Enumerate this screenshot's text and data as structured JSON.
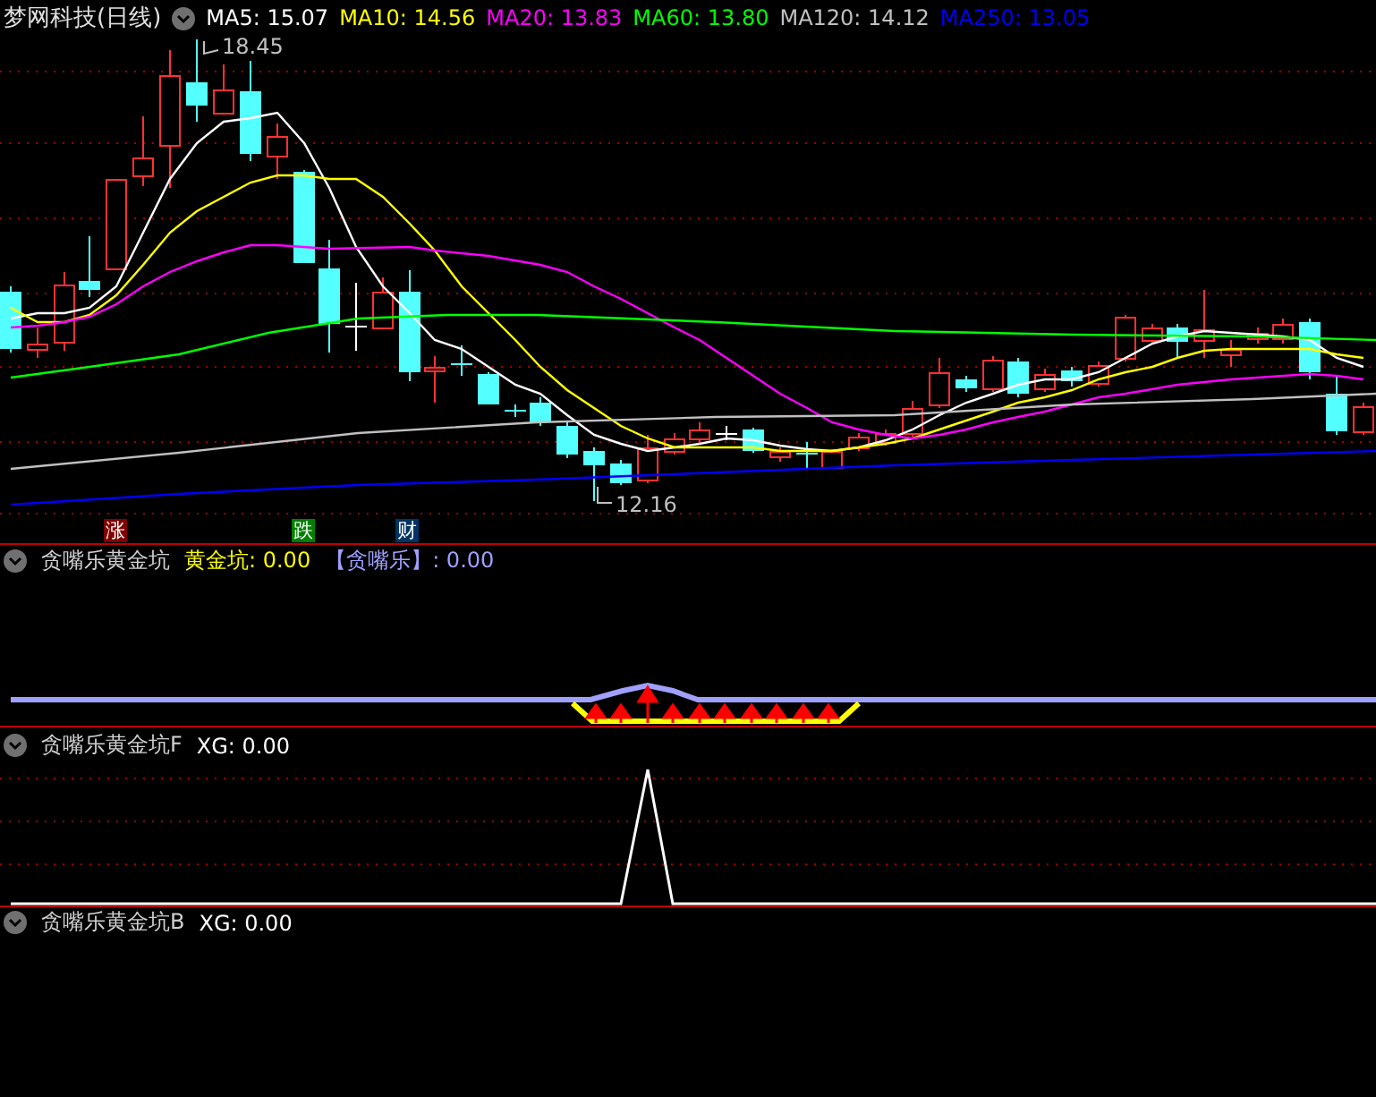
{
  "chart_header": {
    "title": "梦网科技(日线)",
    "indicators": [
      {
        "text": "MA5: 15.07",
        "color": "#ffffff"
      },
      {
        "text": "MA10: 14.56",
        "color": "#ffff00"
      },
      {
        "text": "MA20: 13.83",
        "color": "#ff00ff"
      },
      {
        "text": "MA60: 13.80",
        "color": "#00ff00"
      },
      {
        "text": "MA120: 14.12",
        "color": "#c0c0c0"
      },
      {
        "text": "MA250: 13.05",
        "color": "#0000ff"
      }
    ]
  },
  "price_labels": [
    {
      "kind": "high",
      "text": "18.45"
    },
    {
      "kind": "low",
      "text": "12.16"
    }
  ],
  "event_markers": [
    {
      "text": "涨",
      "color": "#800000"
    },
    {
      "text": "跌",
      "color": "#008000"
    },
    {
      "text": "财",
      "color": "#003366"
    }
  ],
  "panels": [
    {
      "name": "贪嘴乐黄金坑",
      "values": [
        {
          "text": "黄金坑: 0.00",
          "color": "#ffff00"
        },
        {
          "text": "【贪嘴乐】: 0.00",
          "color": "#a0a0ff"
        }
      ]
    },
    {
      "name": "贪嘴乐黄金坑F",
      "values": [
        {
          "text": "XG: 0.00",
          "color": "#ffffff"
        }
      ]
    },
    {
      "name": "贪嘴乐黄金坑B",
      "values": [
        {
          "text": "XG: 0.00",
          "color": "#ffffff"
        }
      ]
    }
  ]
}
